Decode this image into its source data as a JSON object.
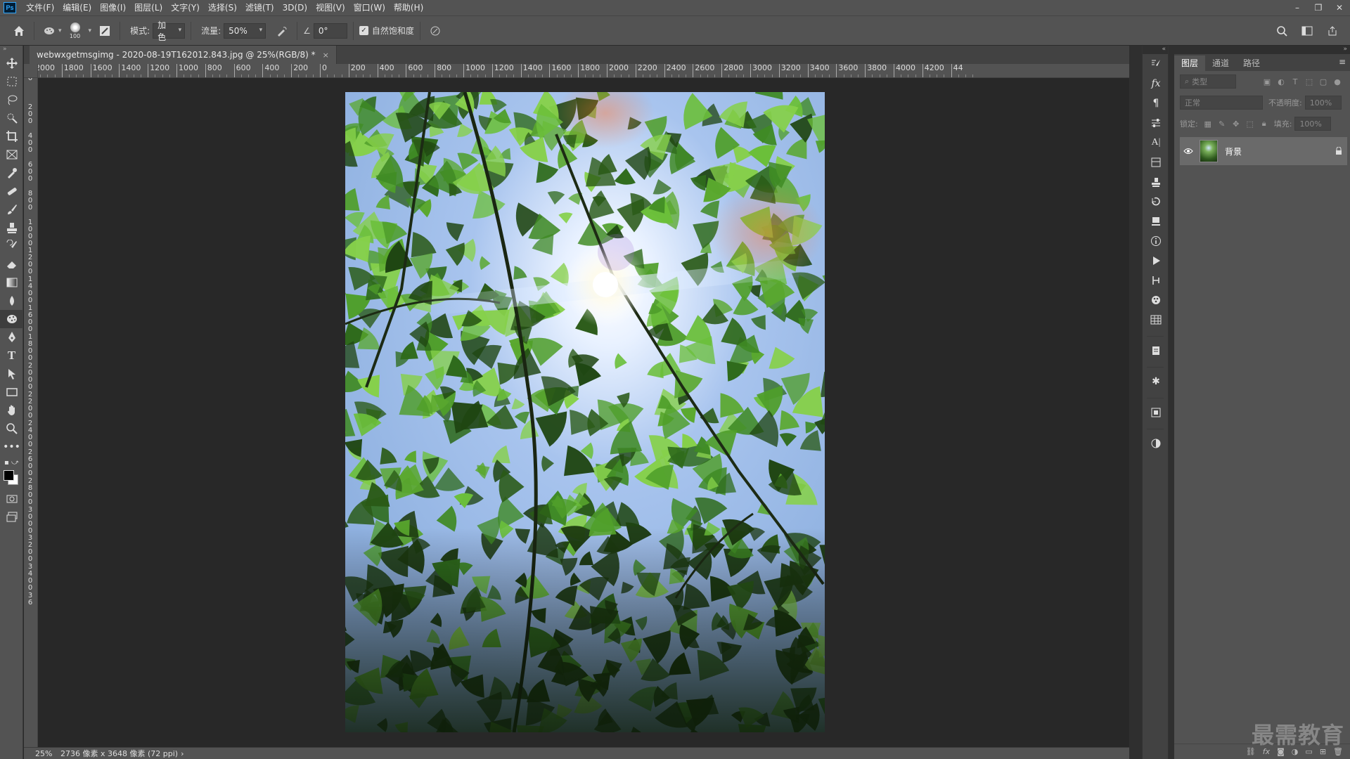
{
  "app": {
    "logo": "Ps"
  },
  "menu": [
    "文件(F)",
    "编辑(E)",
    "图像(I)",
    "图层(L)",
    "文字(Y)",
    "选择(S)",
    "滤镜(T)",
    "3D(D)",
    "视图(V)",
    "窗口(W)",
    "帮助(H)"
  ],
  "window_controls": {
    "minimize": "–",
    "restore": "❐",
    "close": "✕"
  },
  "options": {
    "brush_size": "100",
    "mode_label": "模式:",
    "mode_value": "加色",
    "flow_label": "流量:",
    "flow_value": "50%",
    "angle_value": "0°",
    "vibrance_label": "自然饱和度",
    "vibrance_checked": true
  },
  "document": {
    "tab_title": "webwxgetmsgimg - 2020-08-19T162012.843.jpg @ 25%(RGB/8) *",
    "close": "×"
  },
  "ruler_h": [
    "2000",
    "1800",
    "1600",
    "1400",
    "1200",
    "1000",
    "800",
    "600",
    "400",
    "200",
    "0",
    "200",
    "400",
    "600",
    "800",
    "1000",
    "1200",
    "1400",
    "1600",
    "1800",
    "2000",
    "2200",
    "2400",
    "2600",
    "2800",
    "3000",
    "3200",
    "3400",
    "3600",
    "3800",
    "4000",
    "4200",
    "44"
  ],
  "ruler_v": [
    "0",
    "2 0 0",
    "4 0 0",
    "6 0 0",
    "8 0 0",
    "1 0 0 0",
    "1 2 0 0",
    "1 4 0 0",
    "1 6 0 0",
    "1 8 0 0",
    "2 0 0 0",
    "2 2 0 0",
    "2 4 0 0",
    "2 6 0 0",
    "2 8 0 0",
    "3 0 0 0",
    "3 2 0 0",
    "3 4 0 0",
    "3 6"
  ],
  "status": {
    "zoom": "25%",
    "info": "2736 像素 x 3648 像素 (72 ppi)",
    "arrow": "›"
  },
  "panel": {
    "tabs": [
      "图层",
      "通道",
      "路径"
    ],
    "active_tab": 0,
    "filter_placeholder": "类型",
    "blend_mode": "正常",
    "opacity_label": "不透明度:",
    "opacity_value": "100%",
    "lock_label": "锁定:",
    "fill_label": "填充:",
    "fill_value": "100%",
    "layers": [
      {
        "name": "背景",
        "visible": true,
        "locked": true
      }
    ]
  },
  "watermark": "最需教育"
}
